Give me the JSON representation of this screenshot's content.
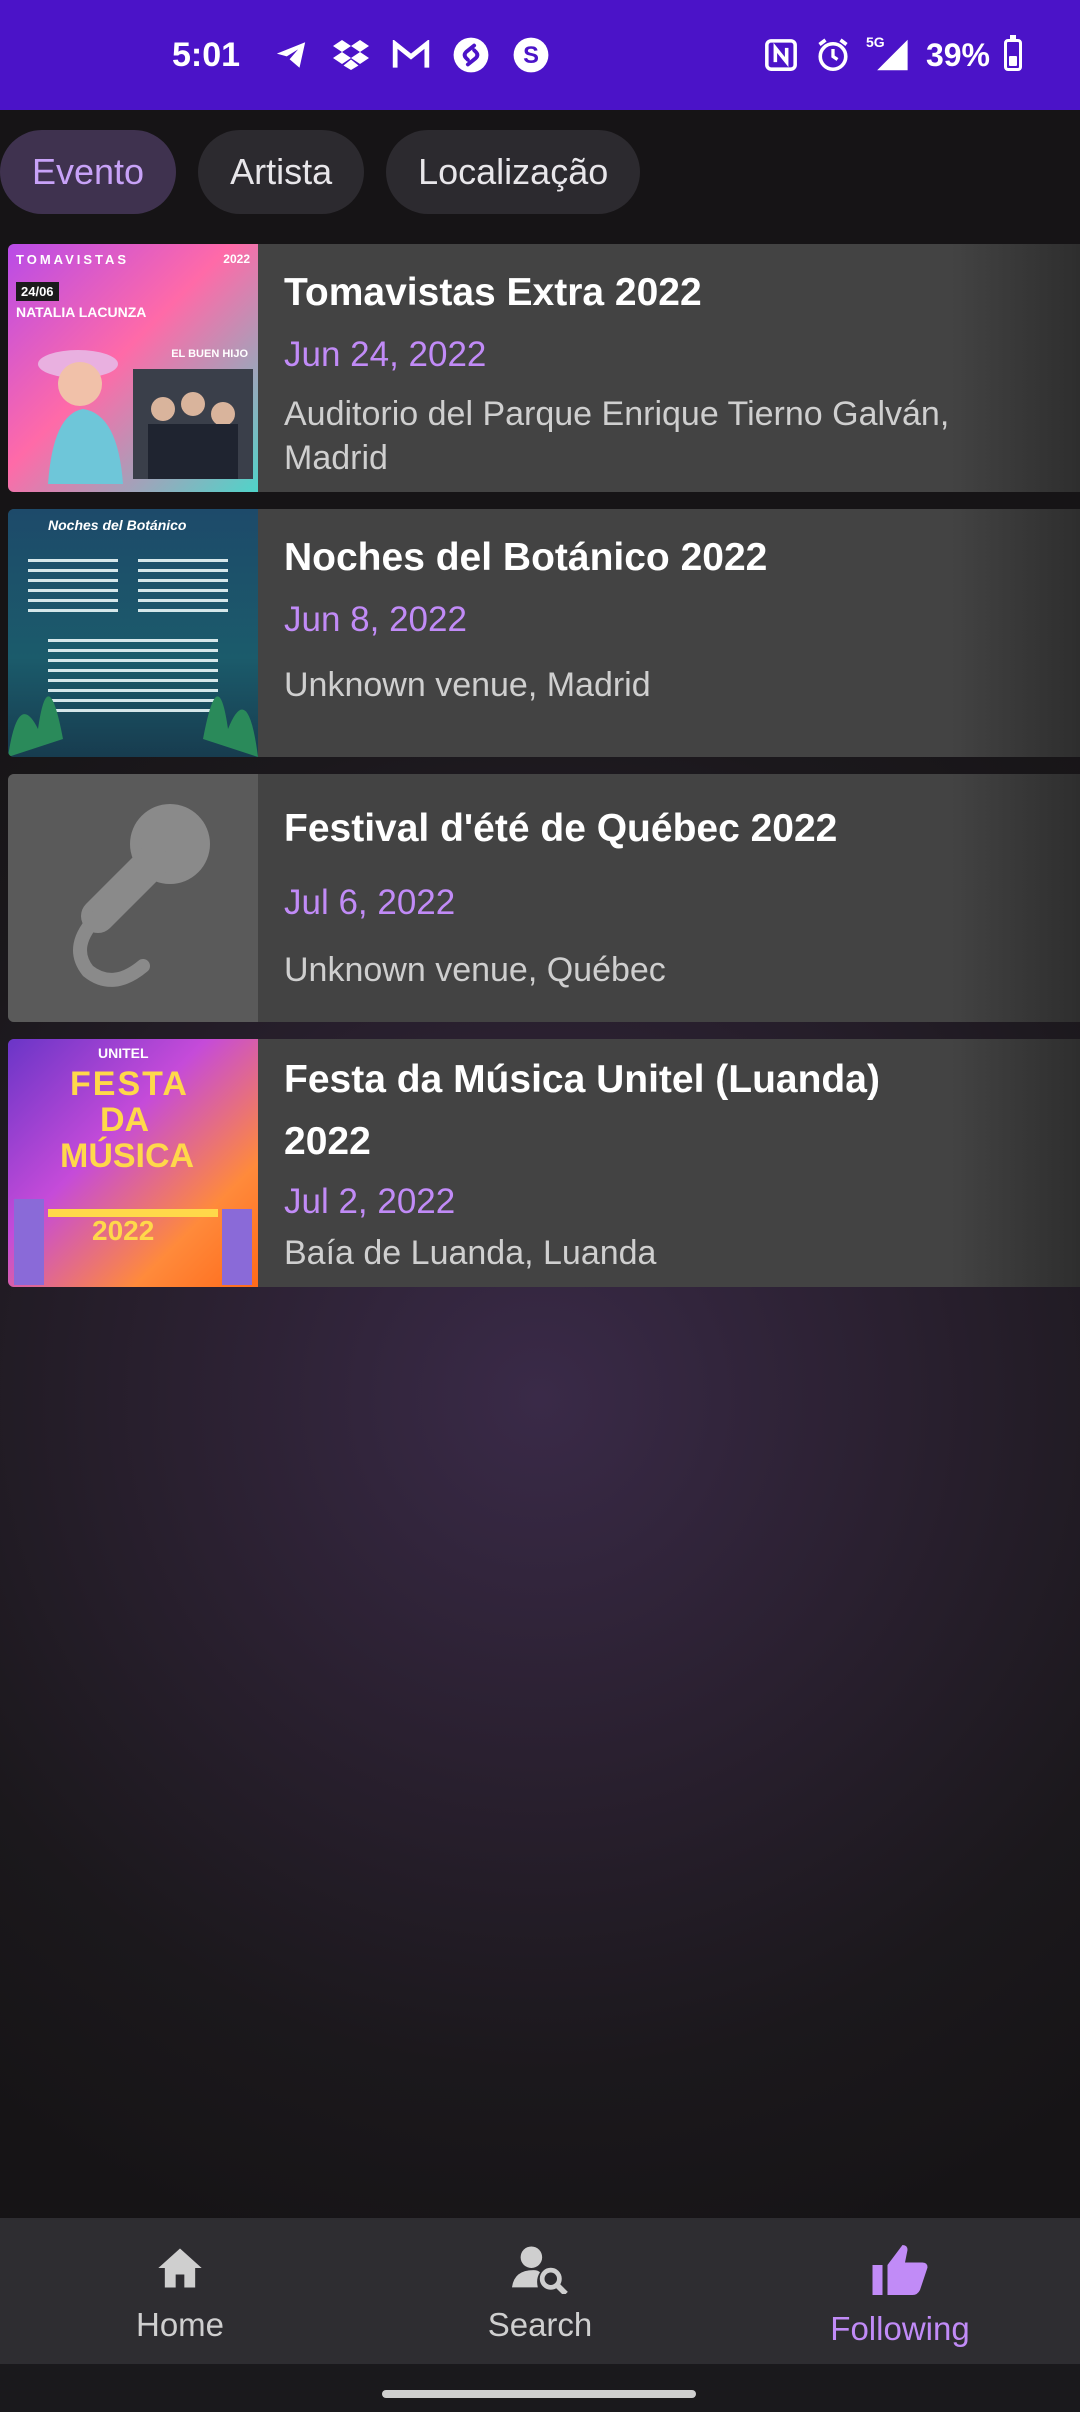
{
  "status_bar": {
    "time": "5:01",
    "battery": "39%",
    "battery_level": 0.39,
    "network": "5G",
    "icons": [
      "telegram-icon",
      "dropbox-icon",
      "gmail-icon",
      "shazam-icon",
      "s-app-icon",
      "nfc-icon",
      "alarm-icon",
      "signal-icon",
      "battery-icon"
    ]
  },
  "filters": [
    {
      "label": "Evento",
      "selected": true
    },
    {
      "label": "Artista",
      "selected": false
    },
    {
      "label": "Localização",
      "selected": false
    }
  ],
  "events": [
    {
      "title": "Tomavistas Extra 2022",
      "date": "Jun 24, 2022",
      "venue": "Auditorio del Parque Enrique Tierno Galván, Madrid"
    },
    {
      "title": "Noches del Botánico 2022",
      "date": "Jun 8, 2022",
      "venue": "Unknown venue, Madrid"
    },
    {
      "title": "Festival d'été de Québec 2022",
      "date": "Jul 6, 2022",
      "venue": "Unknown venue, Québec"
    },
    {
      "title": "Festa da Música Unitel (Luanda) 2022",
      "date": "Jul 2, 2022",
      "venue": "Baía de Luanda, Luanda"
    }
  ],
  "poster_text": {
    "p1_brand": "TOMAVISTAS",
    "p1_year": "2022",
    "p1_date": "24/06",
    "p1_artist": "NATALIA LACUNZA",
    "p1_artist2": "EL BUEN HIJO",
    "p2_brand": "Noches del Botánico",
    "p4_brand": "UNITEL",
    "p4_line1": "FESTA",
    "p4_line2": "DA",
    "p4_line3": "MÚSICA",
    "p4_year": "2022"
  },
  "nav": [
    {
      "label": "Home",
      "icon": "home-icon",
      "active": false
    },
    {
      "label": "Search",
      "icon": "person-search-icon",
      "active": false
    },
    {
      "label": "Following",
      "icon": "thumbs-up-icon",
      "active": true
    }
  ],
  "colors": {
    "accent": "#c18bf7",
    "status_bar": "#4b13c8"
  }
}
